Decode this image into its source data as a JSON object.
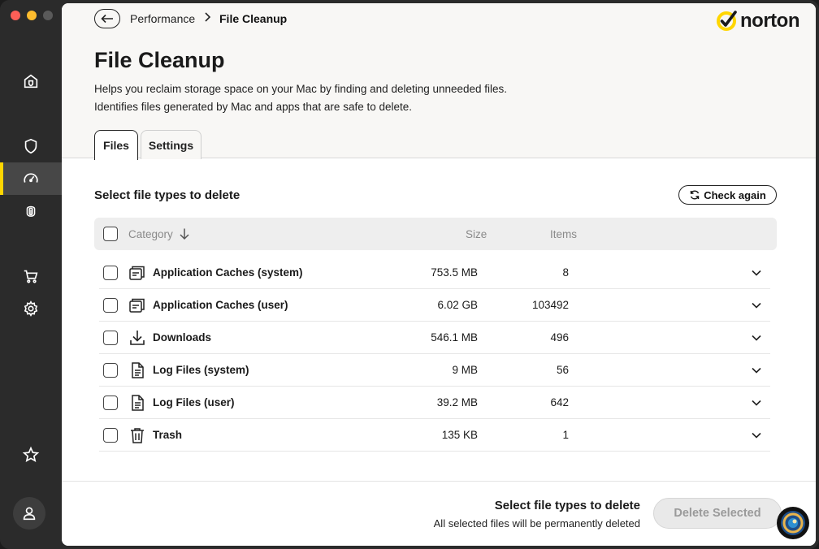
{
  "window": {
    "title": "Norton"
  },
  "sidebar": {
    "items": [
      {
        "name": "home",
        "icon": "home-shield-icon"
      },
      {
        "name": "security",
        "icon": "shield-icon"
      },
      {
        "name": "performance",
        "icon": "speedometer-icon",
        "active": true
      },
      {
        "name": "privacy",
        "icon": "fingerprint-icon"
      },
      {
        "name": "store",
        "icon": "cart-icon"
      },
      {
        "name": "settings",
        "icon": "gear-icon"
      },
      {
        "name": "favorites",
        "icon": "star-icon"
      },
      {
        "name": "account",
        "icon": "user-icon"
      }
    ]
  },
  "breadcrumb": {
    "parent": "Performance",
    "current": "File Cleanup"
  },
  "brand": {
    "name": "norton",
    "accent": "#ffd600"
  },
  "page": {
    "title": "File Cleanup",
    "desc_line1": "Helps you reclaim storage space on your Mac by finding and deleting unneeded files.",
    "desc_line2": "Identifies files generated by Mac and apps that are safe to delete."
  },
  "tabs": {
    "files": "Files",
    "settings": "Settings",
    "active": "Files"
  },
  "section": {
    "title": "Select file types to delete",
    "check_again": "Check again"
  },
  "table": {
    "headers": {
      "category": "Category",
      "size": "Size",
      "items": "Items"
    },
    "rows": [
      {
        "name": "Application Caches (system)",
        "size": "753.5 MB",
        "items": "8",
        "icon": "cache-icon"
      },
      {
        "name": "Application Caches (user)",
        "size": "6.02 GB",
        "items": "103492",
        "icon": "cache-icon"
      },
      {
        "name": "Downloads",
        "size": "546.1 MB",
        "items": "496",
        "icon": "download-icon"
      },
      {
        "name": "Log Files (system)",
        "size": "9 MB",
        "items": "56",
        "icon": "document-icon"
      },
      {
        "name": "Log Files (user)",
        "size": "39.2 MB",
        "items": "642",
        "icon": "document-icon"
      },
      {
        "name": "Trash",
        "size": "135 KB",
        "items": "1",
        "icon": "trash-icon"
      }
    ]
  },
  "footer": {
    "title": "Select file types to delete",
    "subtitle": "All selected files will be permanently deleted",
    "delete_label": "Delete Selected"
  }
}
